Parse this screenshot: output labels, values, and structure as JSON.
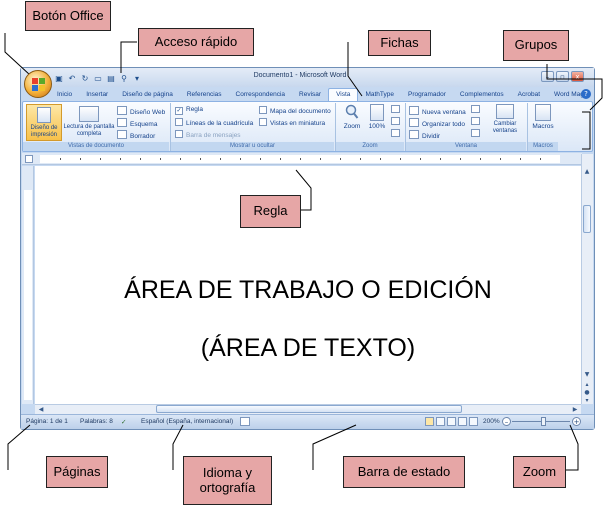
{
  "callouts": {
    "office_button": "Botón Office",
    "quick_access": "Acceso rápido",
    "tabs": "Fichas",
    "groups": "Grupos",
    "ruler": "Regla",
    "pages": "Páginas",
    "language": "Idioma y ortografía",
    "status_bar": "Barra de estado",
    "zoom": "Zoom"
  },
  "window": {
    "title": "Documento1 - Microsoft Word"
  },
  "tabs": [
    "Inicio",
    "Insertar",
    "Diseño de página",
    "Referencias",
    "Correspondencia",
    "Revisar",
    "Vista",
    "MathType",
    "Programador",
    "Complementos",
    "Acrobat",
    "Word Magic"
  ],
  "active_tab": "Vista",
  "ribbon": {
    "views": {
      "print_layout": "Diseño de impresión",
      "full_screen": "Lectura de pantalla completa",
      "web_layout": "Diseño Web",
      "outline": "Esquema",
      "draft": "Borrador",
      "label": "Vistas de documento"
    },
    "show_hide": {
      "ruler": "Regla",
      "gridlines": "Líneas de la cuadrícula",
      "message_bar": "Barra de mensajes",
      "doc_map": "Mapa del documento",
      "thumbnails": "Vistas en miniatura",
      "label": "Mostrar u ocultar"
    },
    "zoom": {
      "zoom": "Zoom",
      "percent": "100%",
      "label": "Zoom"
    },
    "window": {
      "new_window": "Nueva ventana",
      "arrange_all": "Organizar todo",
      "split": "Dividir",
      "switch_windows": "Cambiar ventanas",
      "label": "Ventana"
    },
    "macros": {
      "macros": "Macros",
      "label": "Macros"
    }
  },
  "document": {
    "line1": "ÁREA DE TRABAJO O EDICIÓN",
    "line2": "(ÁREA DE TEXTO)"
  },
  "status": {
    "page": "Página: 1 de 1",
    "words": "Palabras: 8",
    "language": "Español (España, internacional)",
    "zoom": "200%"
  },
  "colors": {
    "callout_fill": "#e6a6a6",
    "ribbon_bg": "#dbe7f7",
    "text_blue": "#15428b"
  }
}
